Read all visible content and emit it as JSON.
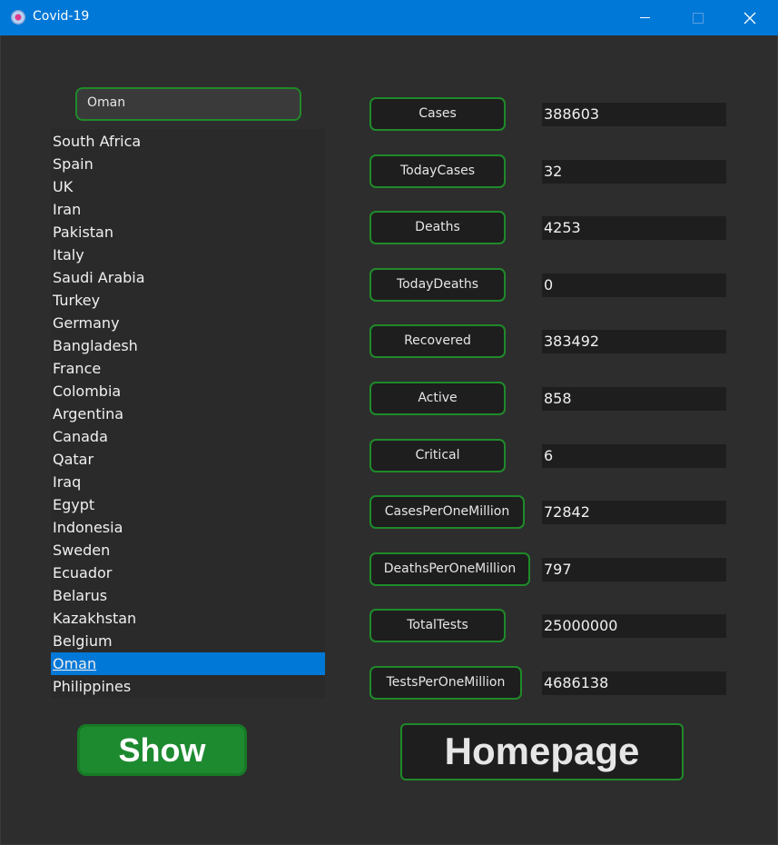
{
  "window": {
    "title": "Covid-19"
  },
  "search": {
    "value": "Oman"
  },
  "countries": [
    "South Africa",
    "Spain",
    "UK",
    "Iran",
    "Pakistan",
    "Italy",
    "Saudi Arabia",
    "Turkey",
    "Germany",
    "Bangladesh",
    "France",
    "Colombia",
    "Argentina",
    "Canada",
    "Qatar",
    "Iraq",
    "Egypt",
    "Indonesia",
    "Sweden",
    "Ecuador",
    "Belarus",
    "Kazakhstan",
    "Belgium",
    "Oman",
    "Philippines"
  ],
  "selected_country": "Oman",
  "stats": [
    {
      "label": "Cases",
      "value": "388603"
    },
    {
      "label": "TodayCases",
      "value": "32"
    },
    {
      "label": "Deaths",
      "value": "4253"
    },
    {
      "label": "TodayDeaths",
      "value": "0"
    },
    {
      "label": "Recovered",
      "value": "383492"
    },
    {
      "label": "Active",
      "value": "858"
    },
    {
      "label": "Critical",
      "value": "6"
    },
    {
      "label": "CasesPerOneMillion",
      "value": "72842"
    },
    {
      "label": "DeathsPerOneMillion",
      "value": "797"
    },
    {
      "label": "TotalTests",
      "value": "25000000"
    },
    {
      "label": "TestsPerOneMillion",
      "value": "4686138"
    }
  ],
  "buttons": {
    "show": "Show",
    "homepage": "Homepage"
  },
  "colors": {
    "accent_green": "#1f8a2a",
    "selection_blue": "#0078d7",
    "background": "#2d2d2d"
  }
}
